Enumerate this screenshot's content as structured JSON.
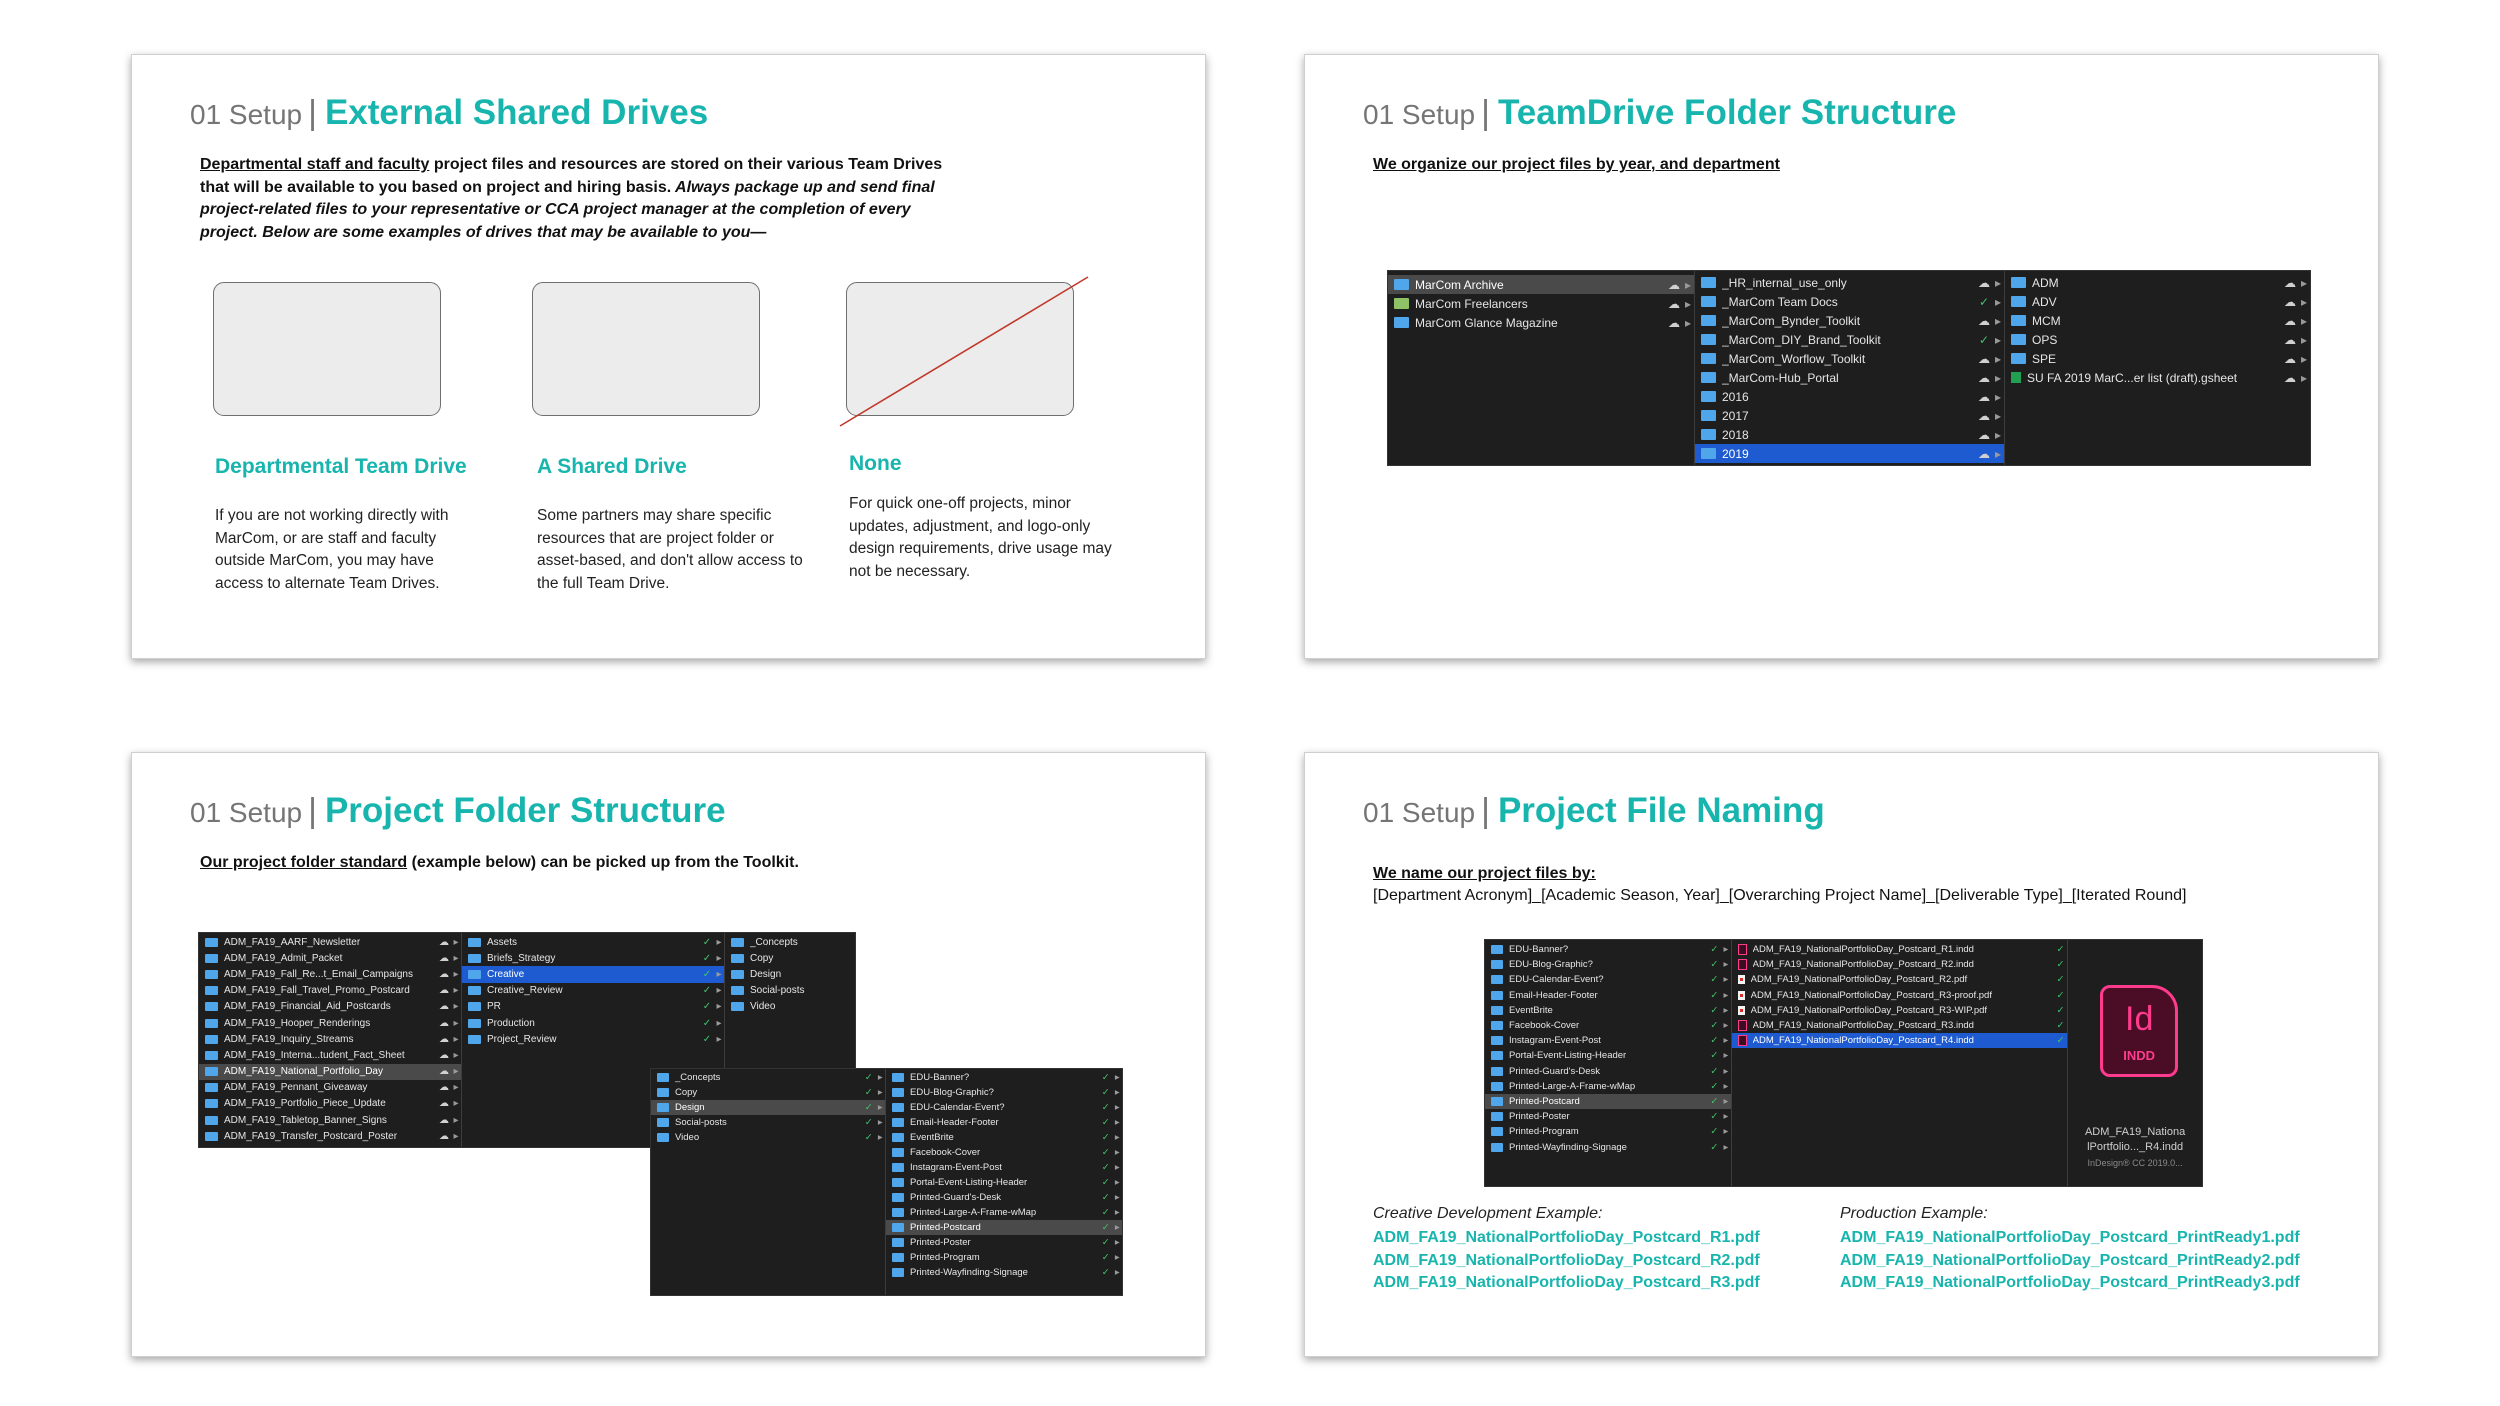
{
  "slide1": {
    "section": "01 Setup",
    "separator": "|",
    "title": "External Shared Drives",
    "intro_underlined": "Departmental staff and faculty",
    "intro_bold": " project files and resources are stored on their various Team Drives that will be available to you based on project and hiring basis.",
    "intro_italic": " Always package up and send final project-related files to your representative or CCA project manager at the completion of every project. Below are some examples of drives that may be available to you—",
    "cards": [
      {
        "title": "Departmental Team Drive",
        "text": "If you are not working directly with MarCom, or are staff and faculty outside MarCom, you may have access to alternate Team Drives."
      },
      {
        "title": "A Shared Drive",
        "text": "Some partners may share specific resources that are project folder or asset-based, and don't allow access to the full Team Drive."
      },
      {
        "title": "None",
        "text": "For quick one-off projects, minor updates, adjustment, and logo-only design requirements, drive usage may not be necessary."
      }
    ]
  },
  "slide2": {
    "section": "01 Setup",
    "separator": "|",
    "title": "TeamDrive Folder Structure",
    "intro": "We organize our project files by year, and department",
    "finder": {
      "col1": [
        {
          "name": "MarCom Archive",
          "status": "☁",
          "hl": true
        },
        {
          "name": "MarCom Freelancers",
          "status": "☁",
          "green": true
        },
        {
          "name": "MarCom Glance Magazine",
          "status": "☁"
        }
      ],
      "col2": [
        {
          "name": "_HR_internal_use_only",
          "status": "☁"
        },
        {
          "name": "_MarCom Team Docs",
          "status": "✓",
          "ok": true
        },
        {
          "name": "_MarCom_Bynder_Toolkit",
          "status": "☁"
        },
        {
          "name": "_MarCom_DIY_Brand_Toolkit",
          "status": "✓",
          "ok": true
        },
        {
          "name": "_MarCom_Worflow_Toolkit",
          "status": "☁"
        },
        {
          "name": "_MarCom-Hub_Portal",
          "status": "☁"
        },
        {
          "name": "2016",
          "status": "☁"
        },
        {
          "name": "2017",
          "status": "☁"
        },
        {
          "name": "2018",
          "status": "☁"
        },
        {
          "name": "2019",
          "status": "☁",
          "sel": true
        }
      ],
      "col3": [
        {
          "name": "ADM",
          "status": "☁"
        },
        {
          "name": "ADV",
          "status": "☁"
        },
        {
          "name": "MCM",
          "status": "☁"
        },
        {
          "name": "OPS",
          "status": "☁"
        },
        {
          "name": "SPE",
          "status": "☁"
        },
        {
          "name": "SU FA 2019 MarC...er list (draft).gsheet",
          "status": "☁",
          "sheet": true
        }
      ]
    }
  },
  "slide3": {
    "section": "01 Setup",
    "separator": "|",
    "title": "Project Folder Structure",
    "intro_underlined": "Our project folder standard",
    "intro_rest": " (example below) can be picked up from the Toolkit.",
    "finderA": {
      "col1": [
        {
          "name": "ADM_FA19_AARF_Newsletter",
          "status": "☁"
        },
        {
          "name": "ADM_FA19_Admit_Packet",
          "status": "☁"
        },
        {
          "name": "ADM_FA19_Fall_Re...t_Email_Campaigns",
          "status": "☁"
        },
        {
          "name": "ADM_FA19_Fall_Travel_Promo_Postcard",
          "status": "☁"
        },
        {
          "name": "ADM_FA19_Financial_Aid_Postcards",
          "status": "☁"
        },
        {
          "name": "ADM_FA19_Hooper_Renderings",
          "status": "☁"
        },
        {
          "name": "ADM_FA19_Inquiry_Streams",
          "status": "☁"
        },
        {
          "name": "ADM_FA19_Interna...tudent_Fact_Sheet",
          "status": "☁"
        },
        {
          "name": "ADM_FA19_National_Portfolio_Day",
          "status": "☁",
          "hl": true
        },
        {
          "name": "ADM_FA19_Pennant_Giveaway",
          "status": "☁"
        },
        {
          "name": "ADM_FA19_Portfolio_Piece_Update",
          "status": "☁"
        },
        {
          "name": "ADM_FA19_Tabletop_Banner_Signs",
          "status": "☁"
        },
        {
          "name": "ADM_FA19_Transfer_Postcard_Poster",
          "status": "☁"
        }
      ],
      "col2": [
        {
          "name": "Assets",
          "status": "✓",
          "ok": true
        },
        {
          "name": "Briefs_Strategy",
          "status": "✓",
          "ok": true
        },
        {
          "name": "Creative",
          "status": "✓",
          "ok": true,
          "sel": true
        },
        {
          "name": "Creative_Review",
          "status": "✓",
          "ok": true
        },
        {
          "name": "PR",
          "status": "✓",
          "ok": true
        },
        {
          "name": "Production",
          "status": "✓",
          "ok": true
        },
        {
          "name": "Project_Review",
          "status": "✓",
          "ok": true
        }
      ],
      "col3": [
        {
          "name": "_Concepts"
        },
        {
          "name": "Copy"
        },
        {
          "name": "Design"
        },
        {
          "name": "Social-posts"
        },
        {
          "name": "Video"
        }
      ]
    },
    "finderB": {
      "col1": [
        {
          "name": "_Concepts",
          "status": "✓",
          "ok": true
        },
        {
          "name": "Copy",
          "status": "✓",
          "ok": true
        },
        {
          "name": "Design",
          "status": "✓",
          "ok": true,
          "hl": true
        },
        {
          "name": "Social-posts",
          "status": "✓",
          "ok": true
        },
        {
          "name": "Video",
          "status": "✓",
          "ok": true
        }
      ],
      "col2": [
        {
          "name": "EDU-Banner?",
          "status": "✓",
          "ok": true
        },
        {
          "name": "EDU-Blog-Graphic?",
          "status": "✓",
          "ok": true
        },
        {
          "name": "EDU-Calendar-Event?",
          "status": "✓",
          "ok": true
        },
        {
          "name": "Email-Header-Footer",
          "status": "✓",
          "ok": true
        },
        {
          "name": "EventBrite",
          "status": "✓",
          "ok": true
        },
        {
          "name": "Facebook-Cover",
          "status": "✓",
          "ok": true
        },
        {
          "name": "Instagram-Event-Post",
          "status": "✓",
          "ok": true
        },
        {
          "name": "Portal-Event-Listing-Header",
          "status": "✓",
          "ok": true
        },
        {
          "name": "Printed-Guard's-Desk",
          "status": "✓",
          "ok": true
        },
        {
          "name": "Printed-Large-A-Frame-wMap",
          "status": "✓",
          "ok": true
        },
        {
          "name": "Printed-Postcard",
          "status": "✓",
          "ok": true,
          "hl": true
        },
        {
          "name": "Printed-Poster",
          "status": "✓",
          "ok": true
        },
        {
          "name": "Printed-Program",
          "status": "✓",
          "ok": true
        },
        {
          "name": "Printed-Wayfinding-Signage",
          "status": "✓",
          "ok": true
        }
      ]
    }
  },
  "slide4": {
    "section": "01 Setup",
    "separator": "|",
    "title": "Project File Naming",
    "intro_heading": "We name our project files by:",
    "intro_pattern": "[Department Acronym]_[Academic Season, Year]_[Overarching Project Name]_[Deliverable Type]_[Iterated Round]",
    "finder": {
      "col1": [
        {
          "name": "EDU-Banner?",
          "status": "✓",
          "ok": true
        },
        {
          "name": "EDU-Blog-Graphic?",
          "status": "✓",
          "ok": true
        },
        {
          "name": "EDU-Calendar-Event?",
          "status": "✓",
          "ok": true
        },
        {
          "name": "Email-Header-Footer",
          "status": "✓",
          "ok": true
        },
        {
          "name": "EventBrite",
          "status": "✓",
          "ok": true
        },
        {
          "name": "Facebook-Cover",
          "status": "✓",
          "ok": true
        },
        {
          "name": "Instagram-Event-Post",
          "status": "✓",
          "ok": true
        },
        {
          "name": "Portal-Event-Listing-Header",
          "status": "✓",
          "ok": true
        },
        {
          "name": "Printed-Guard's-Desk",
          "status": "✓",
          "ok": true
        },
        {
          "name": "Printed-Large-A-Frame-wMap",
          "status": "✓",
          "ok": true
        },
        {
          "name": "Printed-Postcard",
          "status": "✓",
          "ok": true,
          "hl": true
        },
        {
          "name": "Printed-Poster",
          "status": "✓",
          "ok": true
        },
        {
          "name": "Printed-Program",
          "status": "✓",
          "ok": true
        },
        {
          "name": "Printed-Wayfinding-Signage",
          "status": "✓",
          "ok": true
        }
      ],
      "col2": [
        {
          "name": "ADM_FA19_NationalPortfolioDay_Postcard_R1.indd",
          "status": "✓",
          "ok": true,
          "icon": "ind"
        },
        {
          "name": "ADM_FA19_NationalPortfolioDay_Postcard_R2.indd",
          "status": "✓",
          "ok": true,
          "icon": "ind"
        },
        {
          "name": "ADM_FA19_NationalPortfolioDay_Postcard_R2.pdf",
          "status": "✓",
          "ok": true,
          "icon": "pdf"
        },
        {
          "name": "ADM_FA19_NationalPortfolioDay_Postcard_R3-proof.pdf",
          "status": "✓",
          "ok": true,
          "icon": "pdf"
        },
        {
          "name": "ADM_FA19_NationalPortfolioDay_Postcard_R3-WIP.pdf",
          "status": "✓",
          "ok": true,
          "icon": "pdf"
        },
        {
          "name": "ADM_FA19_NationalPortfolioDay_Postcard_R3.indd",
          "status": "✓",
          "ok": true,
          "icon": "ind"
        },
        {
          "name": "ADM_FA19_NationalPortfolioDay_Postcard_R4.indd",
          "status": "✓",
          "ok": true,
          "icon": "ind",
          "sel": true
        }
      ],
      "preview": {
        "badge_big": "Id",
        "badge_small": "INDD",
        "name_line1": "ADM_FA19_Nationa",
        "name_line2": "lPortfolio..._R4.indd",
        "kind": "InDesign® CC 2019.0..."
      }
    },
    "creative_label": "Creative Development Example:",
    "creative_files": [
      "ADM_FA19_NationalPortfolioDay_Postcard_R1.pdf",
      "ADM_FA19_NationalPortfolioDay_Postcard_R2.pdf",
      "ADM_FA19_NationalPortfolioDay_Postcard_R3.pdf"
    ],
    "production_label": "Production Example:",
    "production_files": [
      "ADM_FA19_NationalPortfolioDay_Postcard_PrintReady1.pdf",
      "ADM_FA19_NationalPortfolioDay_Postcard_PrintReady2.pdf",
      "ADM_FA19_NationalPortfolioDay_Postcard_PrintReady3.pdf"
    ],
    "icons": {
      "chevron": "chevron-right-icon",
      "cloud": "cloud-icon",
      "synced": "check-circle-icon"
    }
  },
  "colors": {
    "accent": "#17b5ad",
    "finder_bg": "#1e1e1e",
    "selection": "#1f5bd0",
    "folder": "#4fa6ea"
  }
}
